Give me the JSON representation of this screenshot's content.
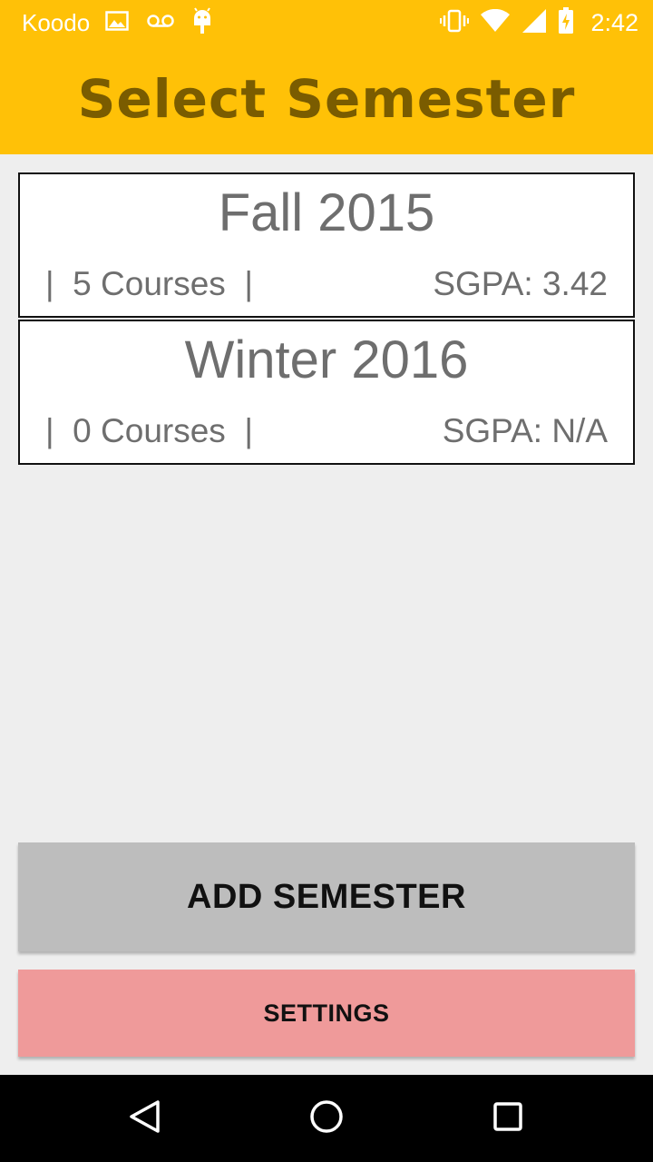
{
  "status_bar": {
    "carrier": "Koodo",
    "time": "2:42",
    "left_icons": [
      "image-icon",
      "voicemail-icon",
      "android-debug-icon"
    ],
    "right_icons": [
      "vibrate-icon",
      "wifi-icon",
      "cell-signal-icon",
      "battery-charging-icon"
    ]
  },
  "app_bar": {
    "title": "Select Semester"
  },
  "semesters": [
    {
      "name": "Fall 2015",
      "courses": "|  5 Courses  |",
      "sgpa": "SGPA: 3.42"
    },
    {
      "name": "Winter 2016",
      "courses": "|  0 Courses  |",
      "sgpa": "SGPA: N/A"
    }
  ],
  "buttons": {
    "add_semester": "ADD SEMESTER",
    "settings": "SETTINGS"
  },
  "nav_bar": {
    "icons": [
      "back-icon",
      "home-icon",
      "recents-icon"
    ]
  },
  "colors": {
    "app_bar": "#ffc107",
    "title_text": "#7a5c00",
    "background": "#eeeeee",
    "add_button": "#bdbdbd",
    "settings_button": "#ef9a9a",
    "nav_bar": "#000000"
  }
}
